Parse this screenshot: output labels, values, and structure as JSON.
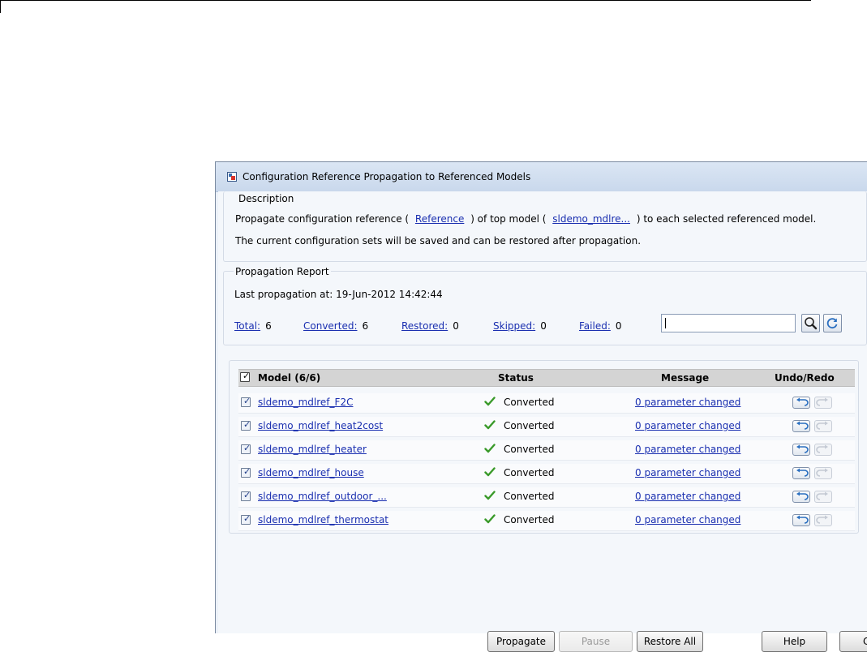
{
  "window": {
    "title": "Configuration Reference Propagation to Referenced Models"
  },
  "description": {
    "title": "Description",
    "line1_prefix": "Propagate configuration reference (",
    "reference_link": "Reference",
    "line1_mid": ") of top model (",
    "model_link": "sldemo_mdlre...",
    "line1_suffix": ") to each selected referenced model.",
    "line2": "The current configuration sets will be saved and can be restored after propagation."
  },
  "report": {
    "title": "Propagation Report",
    "last_propagation": "Last propagation at: 19-Jun-2012 14:42:44",
    "stats": [
      {
        "label": "Total:",
        "value": "6"
      },
      {
        "label": "Converted:",
        "value": "6"
      },
      {
        "label": "Restored:",
        "value": "0"
      },
      {
        "label": "Skipped:",
        "value": "0"
      },
      {
        "label": "Failed:",
        "value": "0"
      }
    ],
    "filter_value": "",
    "search_icon": "magnifier-icon",
    "refresh_icon": "refresh-icon"
  },
  "table": {
    "columns": {
      "model": "Model (6/6)",
      "status": "Status",
      "message": "Message",
      "undo_redo": "Undo/Redo"
    },
    "rows": [
      {
        "model": "sldemo_mdlref_F2C",
        "status": "Converted",
        "message": "0 parameter changed"
      },
      {
        "model": "sldemo_mdlref_heat2cost",
        "status": "Converted",
        "message": "0 parameter changed"
      },
      {
        "model": "sldemo_mdlref_heater",
        "status": "Converted",
        "message": "0 parameter changed"
      },
      {
        "model": "sldemo_mdlref_house",
        "status": "Converted",
        "message": "0 parameter changed"
      },
      {
        "model": "sldemo_mdlref_outdoor_...",
        "status": "Converted",
        "message": "0 parameter changed"
      },
      {
        "model": "sldemo_mdlref_thermostat",
        "status": "Converted",
        "message": "0 parameter changed"
      }
    ]
  },
  "buttons": {
    "propagate": "Propagate",
    "pause": "Pause",
    "restore_all": "Restore All",
    "help": "Help",
    "close": "C"
  },
  "colors": {
    "link": "#1a2fb0",
    "check": "#3a9a2a",
    "header_bg": "#d4d4d4",
    "window_bg": "#f4f7fb"
  }
}
